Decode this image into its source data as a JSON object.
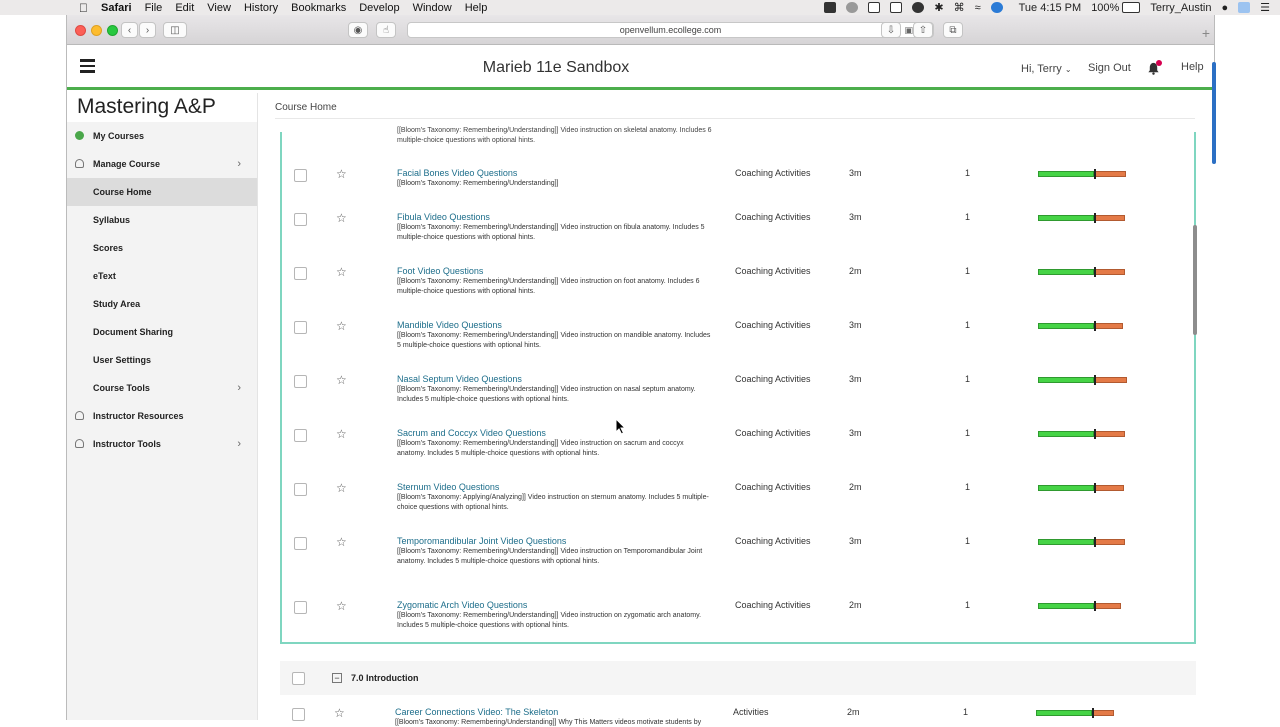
{
  "menubar": {
    "app": "Safari",
    "items": [
      "File",
      "Edit",
      "View",
      "History",
      "Bookmarks",
      "Develop",
      "Window",
      "Help"
    ],
    "clock": "Tue 4:15 PM",
    "battery": "100%",
    "user": "Terry_Austin"
  },
  "browser": {
    "url": "openvellum.ecollege.com"
  },
  "header": {
    "course_title": "Marieb 11e Sandbox",
    "greeting": "Hi, Terry",
    "sign_out": "Sign Out",
    "help": "Help"
  },
  "sidebar": {
    "brand": "Mastering A&P",
    "items": [
      {
        "label": "My Courses"
      },
      {
        "label": "Manage Course"
      },
      {
        "label": "Course Home"
      },
      {
        "label": "Syllabus"
      },
      {
        "label": "Scores"
      },
      {
        "label": "eText"
      },
      {
        "label": "Study Area"
      },
      {
        "label": "Document Sharing"
      },
      {
        "label": "User Settings"
      },
      {
        "label": "Course Tools"
      },
      {
        "label": "Instructor Resources"
      },
      {
        "label": "Instructor Tools"
      }
    ]
  },
  "content": {
    "breadcrumb": "Course Home",
    "partial_top": "[[Bloom's Taxonomy: Remembering/Understanding]] Video instruction on skeletal anatomy. Includes 6 multiple-choice questions with optional hints.",
    "rows": [
      {
        "title": "Facial Bones Video Questions",
        "desc": "[[Bloom's Taxonomy: Remembering/Understanding]]",
        "type": "Coaching Activities",
        "time": "3m",
        "count": "1",
        "green": 0.62,
        "orange": 0.36
      },
      {
        "title": "Fibula Video Questions",
        "desc": "[[Bloom's Taxonomy: Remembering/Understanding]] Video instruction on fibula anatomy. Includes 5 multiple-choice questions with optional  hints.",
        "type": "Coaching Activities",
        "time": "3m",
        "count": "1",
        "green": 0.62,
        "orange": 0.34
      },
      {
        "title": "Foot Video Questions",
        "desc": "[[Bloom's Taxonomy: Remembering/Understanding]] Video instruction on foot anatomy. Includes 6 multiple-choice questions with optional hints.",
        "type": "Coaching Activities",
        "time": "2m",
        "count": "1",
        "green": 0.62,
        "orange": 0.34
      },
      {
        "title": "Mandible Video Questions",
        "desc": "[[Bloom's Taxonomy: Remembering/Understanding]] Video instruction on mandible anatomy. Includes 5 multiple-choice questions with optional hints.",
        "type": "Coaching Activities",
        "time": "3m",
        "count": "1",
        "green": 0.62,
        "orange": 0.32
      },
      {
        "title": "Nasal Septum Video Questions",
        "desc": "[[Bloom's Taxonomy: Remembering/Understanding]] Video instruction on nasal septum anatomy. Includes 5 multiple-choice questions with optional hints.",
        "type": "Coaching Activities",
        "time": "3m",
        "count": "1",
        "green": 0.62,
        "orange": 0.37
      },
      {
        "title": "Sacrum and Coccyx Video Questions",
        "desc": "[[Bloom's Taxonomy: Remembering/Understanding]] Video instruction on sacrum and coccyx anatomy. Includes 5 multiple-choice questions with optional hints.",
        "type": "Coaching Activities",
        "time": "3m",
        "count": "1",
        "green": 0.62,
        "orange": 0.35
      },
      {
        "title": "Sternum Video Questions",
        "desc": "[[Bloom's Taxonomy: Applying/Analyzing]] Video instruction on sternum anatomy. Includes 5 multiple-choice questions with optional hints.",
        "type": "Coaching Activities",
        "time": "2m",
        "count": "1",
        "green": 0.62,
        "orange": 0.33
      },
      {
        "title": "Temporomandibular Joint Video Questions",
        "desc": "[[Bloom's Taxonomy: Remembering/Understanding]] Video instruction on Temporomandibular Joint anatomy. Includes 5 multiple-choice questions with optional hints.",
        "type": "Coaching Activities",
        "time": "3m",
        "count": "1",
        "green": 0.62,
        "orange": 0.35
      },
      {
        "title": "Zygomatic Arch Video Questions",
        "desc": "[[Bloom's Taxonomy: Remembering/Understanding]] Video instruction on zygomatic arch anatomy. Includes 5 multiple-choice questions with optional hints.",
        "type": "Coaching Activities",
        "time": "2m",
        "count": "1",
        "green": 0.62,
        "orange": 0.3
      }
    ],
    "section": {
      "title": "7.0 Introduction",
      "toggle": "−"
    },
    "after_section": [
      {
        "title": "Career Connections Video: The Skeleton",
        "desc": "[[Bloom's Taxonomy: Remembering/Understanding]] Why This Matters videos motivate students by describing how chapter content applies to their future careers",
        "type": "Activities",
        "time": "2m",
        "count": "1",
        "green": 0.62,
        "orange": 0.24
      }
    ]
  }
}
